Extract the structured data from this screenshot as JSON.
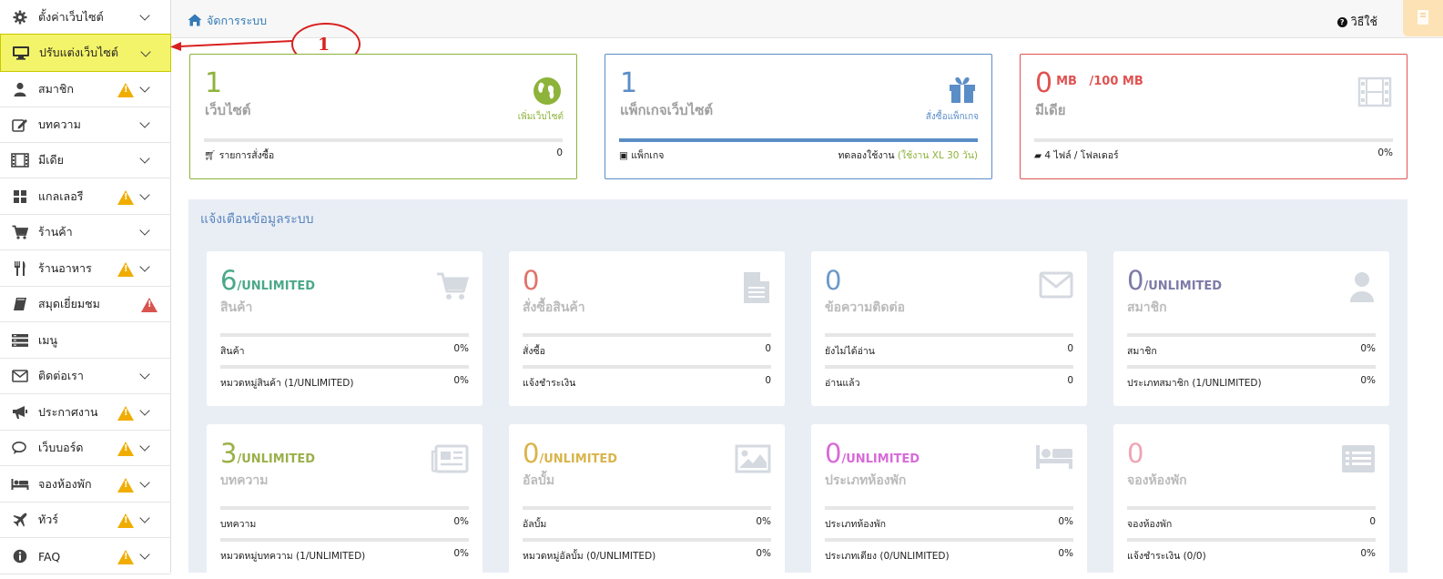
{
  "sidebar": {
    "items": [
      {
        "label": "ตั้งค่าเว็บไซต์",
        "icon": "gear-icon"
      },
      {
        "label": "ปรับแต่งเว็บไซต์",
        "icon": "monitor-icon"
      },
      {
        "label": "สมาชิก",
        "icon": "user-icon"
      },
      {
        "label": "บทความ",
        "icon": "edit-icon"
      },
      {
        "label": "มีเดีย",
        "icon": "film-icon"
      },
      {
        "label": "แกลเลอรี",
        "icon": "grid-icon"
      },
      {
        "label": "ร้านค้า",
        "icon": "cart-icon"
      },
      {
        "label": "ร้านอาหาร",
        "icon": "cutlery-icon"
      },
      {
        "label": "สมุดเยี่ยมชม",
        "icon": "book-icon"
      },
      {
        "label": "เมนู",
        "icon": "menu-icon"
      },
      {
        "label": "ติดต่อเรา",
        "icon": "envelope-icon"
      },
      {
        "label": "ประกาศงาน",
        "icon": "bullhorn-icon"
      },
      {
        "label": "เว็บบอร์ด",
        "icon": "comments-icon"
      },
      {
        "label": "จองห้องพัก",
        "icon": "bed-icon"
      },
      {
        "label": "ทัวร์",
        "icon": "plane-icon"
      },
      {
        "label": "FAQ",
        "icon": "info-icon"
      }
    ]
  },
  "annotation": {
    "number": "1"
  },
  "topbar": {
    "breadcrumb": "จัดการระบบ",
    "help": "วิธีใช้"
  },
  "top_cards": [
    {
      "value": "1",
      "title": "เว็บไซต์",
      "link": "เพิ่มเว็บไซต์",
      "footer_left": "รายการสั่งซื้อ",
      "footer_right": "0",
      "icon": "globe-icon"
    },
    {
      "value": "1",
      "title": "แพ็กเกจเว็บไซต์",
      "link": "สั่งซื้อแพ็กเกจ",
      "footer_left": "แพ็กเกจ",
      "footer_right_prefix": "ทดลองใช้งาน",
      "footer_right_highlight": "(ใช้งาน XL 30 วัน)",
      "icon": "gift-icon",
      "progress": 1.0
    },
    {
      "value": "0",
      "unit": "MB",
      "limit": "/100 MB",
      "title": "มีเดีย",
      "footer_left": "4 ไฟล์ / โฟลเดอร์",
      "footer_right": "0%",
      "icon": "film-icon"
    }
  ],
  "panel": {
    "title": "แจ้งเตือนข้อมูลระบบ",
    "cards": [
      {
        "value": "6",
        "suffix": "/UNLIMITED",
        "title": "สินค้า",
        "icon": "cart-icon",
        "color": "#4aa889",
        "rows": [
          {
            "label": "สินค้า",
            "value": "0%"
          },
          {
            "label": "หมวดหมู่สินค้า (1/UNLIMITED)",
            "value": "0%"
          }
        ]
      },
      {
        "value": "0",
        "suffix": "",
        "title": "สั่งซื้อสินค้า",
        "icon": "file-icon",
        "color": "#e0736a",
        "rows": [
          {
            "label": "สั่งซื้อ",
            "value": "0"
          },
          {
            "label": "แจ้งชำระเงิน",
            "value": "0"
          }
        ]
      },
      {
        "value": "0",
        "suffix": "",
        "title": "ข้อความติดต่อ",
        "icon": "envelope-icon",
        "color": "#6a9ac9",
        "rows": [
          {
            "label": "ยังไม่ได้อ่าน",
            "value": "0"
          },
          {
            "label": "อ่านแล้ว",
            "value": "0"
          }
        ]
      },
      {
        "value": "0",
        "suffix": "/UNLIMITED",
        "title": "สมาชิก",
        "icon": "user-icon",
        "color": "#7b7ba8",
        "rows": [
          {
            "label": "สมาชิก",
            "value": "0%"
          },
          {
            "label": "ประเภทสมาชิก (1/UNLIMITED)",
            "value": "0%"
          }
        ]
      },
      {
        "value": "3",
        "suffix": "/UNLIMITED",
        "title": "บทความ",
        "icon": "newspaper-icon",
        "color": "#9ab04a",
        "rows": [
          {
            "label": "บทความ",
            "value": "0%"
          },
          {
            "label": "หมวดหมู่บทความ (1/UNLIMITED)",
            "value": "0%"
          }
        ]
      },
      {
        "value": "0",
        "suffix": "/UNLIMITED",
        "title": "อัลบั้ม",
        "icon": "image-icon",
        "color": "#d9b44a",
        "rows": [
          {
            "label": "อัลบั้ม",
            "value": "0%"
          },
          {
            "label": "หมวดหมู่อัลบั้ม (0/UNLIMITED)",
            "value": "0%"
          }
        ]
      },
      {
        "value": "0",
        "suffix": "/UNLIMITED",
        "title": "ประเภทห้องพัก",
        "icon": "bed-icon",
        "color": "#d86ad8",
        "rows": [
          {
            "label": "ประเภทห้องพัก",
            "value": "0%"
          },
          {
            "label": "ประเภทเตียง (0/UNLIMITED)",
            "value": "0%"
          }
        ]
      },
      {
        "value": "0",
        "suffix": "",
        "title": "จองห้องพัก",
        "icon": "list-icon",
        "color": "#f0a3b5",
        "rows": [
          {
            "label": "จองห้องพัก",
            "value": "0"
          },
          {
            "label": "แจ้งชำระเงิน (0/0)",
            "value": "0%"
          }
        ]
      }
    ]
  },
  "colors": {
    "green": "#8db33a",
    "blue": "#5b8dc7",
    "red": "#e05252",
    "highlight": "#f4f46a"
  }
}
